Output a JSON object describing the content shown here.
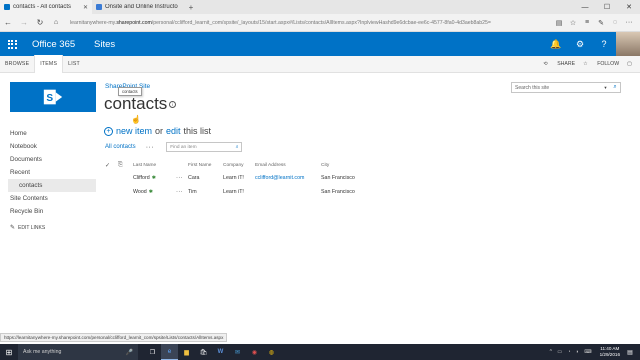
{
  "browser": {
    "tabs": [
      {
        "label": "contacts - All contacts",
        "active": true,
        "close": "✕"
      },
      {
        "label": "Onsite and Online Instructo",
        "active": false,
        "close": ""
      }
    ],
    "new_tab": "+",
    "url_prefix": "learnitanywhere-my.",
    "url_domain": "sharepoint.com",
    "url_rest": "/personal/cclifford_learnit_com/spsite/_layouts/15/start.aspx#/Lists/contacts/AllItems.aspx?InplviewHashd9e6dcbae-ee6c-4577-8fa0-4d3aeb8ab25=",
    "window_min": "—",
    "window_max": "☐",
    "window_close": "✕"
  },
  "suite": {
    "brand": "Office 365",
    "app": "Sites",
    "bell": "🔔",
    "gear": "⚙",
    "help": "?"
  },
  "ribbon": {
    "tabs": [
      "BROWSE",
      "ITEMS",
      "LIST"
    ],
    "share": "SHARE",
    "follow": "FOLLOW"
  },
  "site": {
    "breadcrumb": "SharePoint Site",
    "tooltip": "contacts",
    "title": "contacts",
    "search_placeholder": "Search this site"
  },
  "nav": {
    "items": [
      "Home",
      "Notebook",
      "Documents",
      "Recent"
    ],
    "sub_item": "contacts",
    "after": [
      "Site Contents",
      "Recycle Bin"
    ],
    "edit_links": "EDIT LINKS"
  },
  "actions": {
    "new_item": "new item",
    "or": "or",
    "edit": "edit",
    "this_list": "this list"
  },
  "view": {
    "name": "All contacts",
    "more": "···",
    "find_placeholder": "Find an item"
  },
  "table": {
    "headers": {
      "last_name": "Last Name",
      "first_name": "First Name",
      "company": "Company",
      "email": "Email Address",
      "city": "City"
    },
    "rows": [
      {
        "last_name": "Clifford",
        "first_name": "Cara",
        "company": "Learn iT!",
        "email": "cclifford@learnit.com",
        "city": "San Francisco"
      },
      {
        "last_name": "Wood",
        "first_name": "Tim",
        "company": "Learn iT!",
        "email": "",
        "city": "San Francisco"
      }
    ],
    "new_marker": "✱",
    "row_menu": "···"
  },
  "status_url": "https://learnitanywhere-my.sharepoint.com/personal/cclifford_learnit_com/spsite/Lists/contacts/AllItems.aspx",
  "taskbar": {
    "search_placeholder": "Ask me anything",
    "time": "11:40 AM",
    "date": "1/29/2016"
  }
}
